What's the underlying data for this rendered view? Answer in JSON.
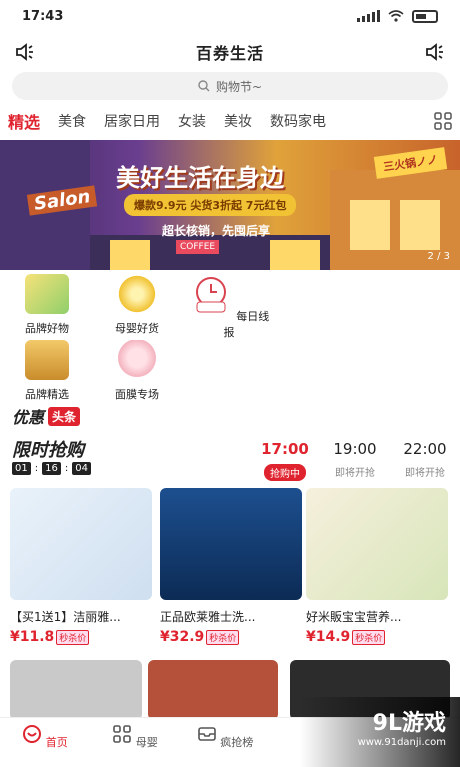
{
  "status_bar": {
    "time": "17:43"
  },
  "header": {
    "title": "百券生活"
  },
  "search": {
    "placeholder": "购物节~"
  },
  "tabs": [
    "精选",
    "美食",
    "居家日用",
    "女装",
    "美妆",
    "数码家电"
  ],
  "banner": {
    "title": "美好生活在身边",
    "promo": "爆款9.9元  尖货3折起  7元红包",
    "subtitle": "超长核销，先囤后享",
    "salon": "Salon",
    "hotpot": "三火锅ノノ",
    "coffee": "COFFEE",
    "pager": "2 / 3"
  },
  "categories": [
    {
      "label": "品牌好物"
    },
    {
      "label": "母婴好货"
    },
    {
      "label": "每日线报"
    },
    {
      "label": "品牌精选"
    },
    {
      "label": "面膜专场"
    }
  ],
  "youhui": {
    "label": "优惠",
    "tag": "头条"
  },
  "flash_sale": {
    "title": "限时抢购",
    "timer": [
      "01",
      "16",
      "04"
    ],
    "sessions": [
      {
        "time": "17:00",
        "status": "抢购中",
        "active": true
      },
      {
        "time": "19:00",
        "status": "即将开抢"
      },
      {
        "time": "22:00",
        "status": "即将开抢"
      }
    ]
  },
  "products": [
    {
      "name": "【买1送1】洁丽雅...",
      "price": "¥11.8",
      "tag": "秒杀价"
    },
    {
      "name": "正品欧莱雅士洗...",
      "price": "¥32.9",
      "tag": "秒杀价"
    },
    {
      "name": "好米販宝宝营养...",
      "price": "¥14.9",
      "tag": "秒杀价"
    }
  ],
  "tabbar": [
    {
      "label": "首页",
      "active": true
    },
    {
      "label": "母婴"
    },
    {
      "label": "疯抢榜"
    }
  ],
  "watermark": {
    "logo": "9L游戏",
    "url": "www.91danji.com"
  },
  "colors": {
    "accent": "#e0242f"
  }
}
